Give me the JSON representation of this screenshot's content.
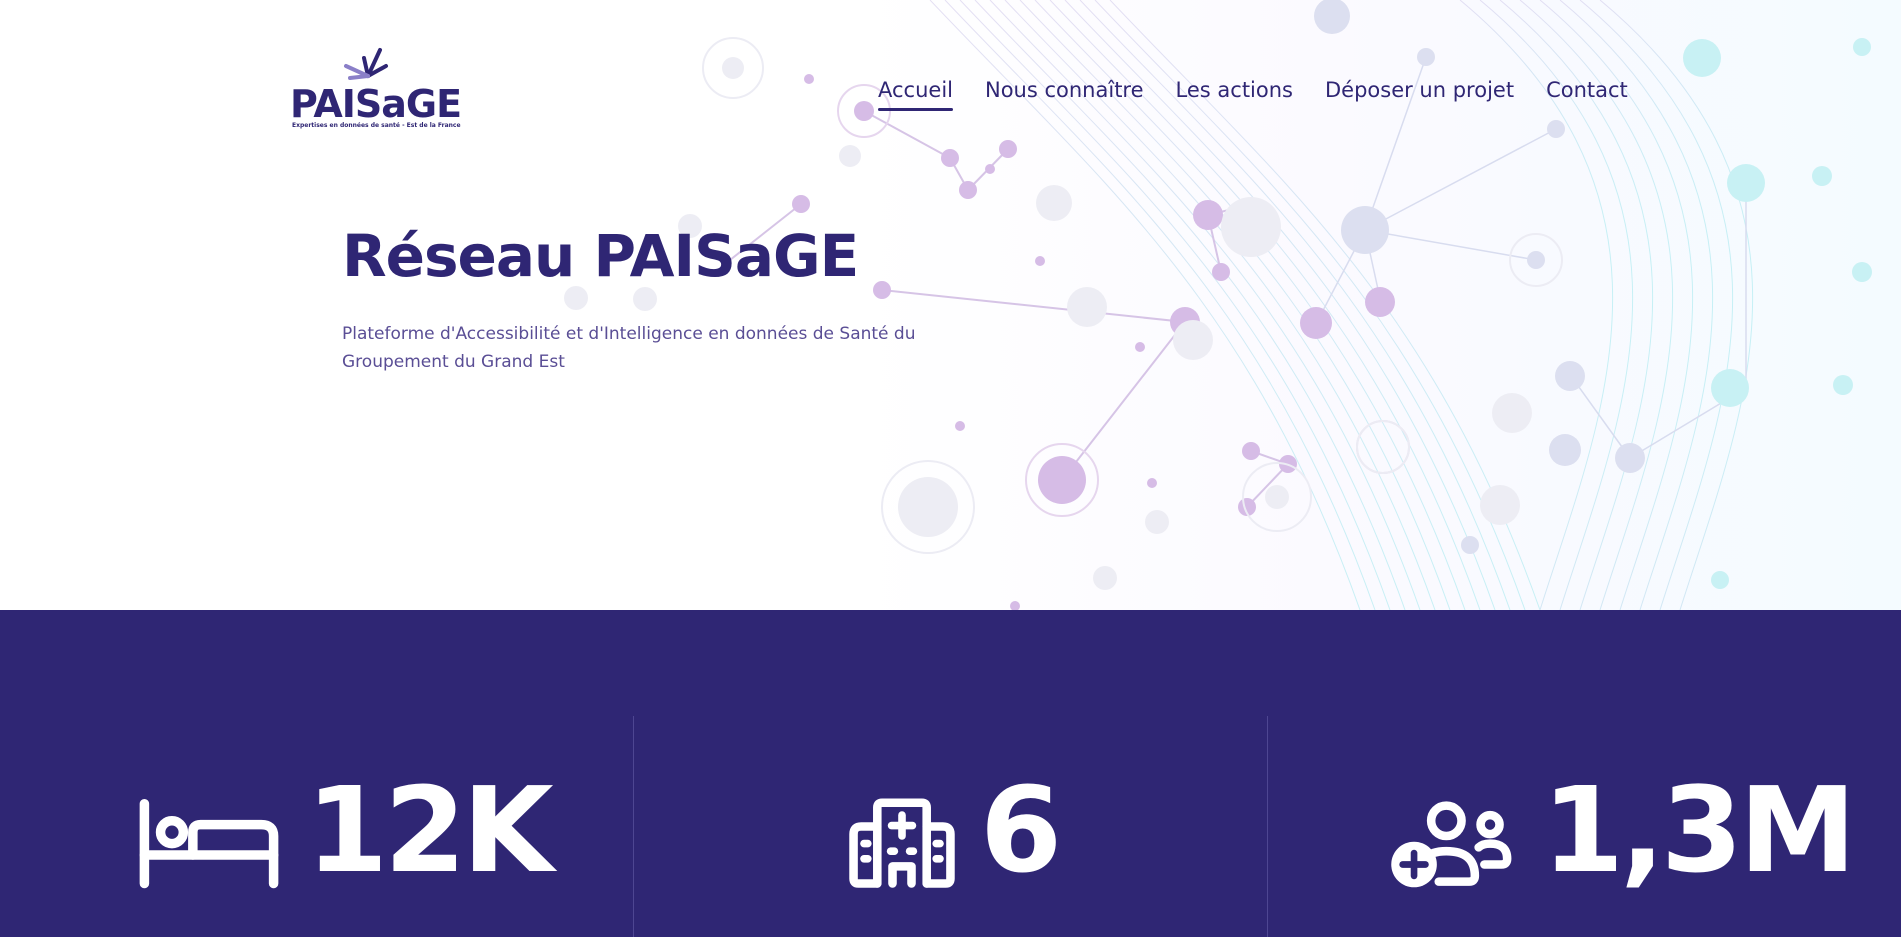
{
  "header": {
    "logo": {
      "word": "PAISaGE",
      "tagline": "Expertises en données de santé - Est de la France"
    },
    "nav": [
      {
        "label": "Accueil",
        "active": true
      },
      {
        "label": "Nous connaître",
        "active": false
      },
      {
        "label": "Les actions",
        "active": false
      },
      {
        "label": "Déposer un projet",
        "active": false
      },
      {
        "label": "Contact",
        "active": false
      }
    ]
  },
  "hero": {
    "title": "Réseau PAISaGE",
    "subtitle": "Plateforme d'Accessibilité et d'Intelligence en données de Santé du Groupement du Grand Est"
  },
  "stats": [
    {
      "icon": "bed-icon",
      "value": "12K"
    },
    {
      "icon": "hospital-icon",
      "value": "6"
    },
    {
      "icon": "patients-icon",
      "value": "1,3M"
    }
  ],
  "colors": {
    "brand": "#2f2674",
    "accent_purple": "#c9a6dc",
    "accent_cyan": "#a9ecf2",
    "white": "#ffffff"
  }
}
